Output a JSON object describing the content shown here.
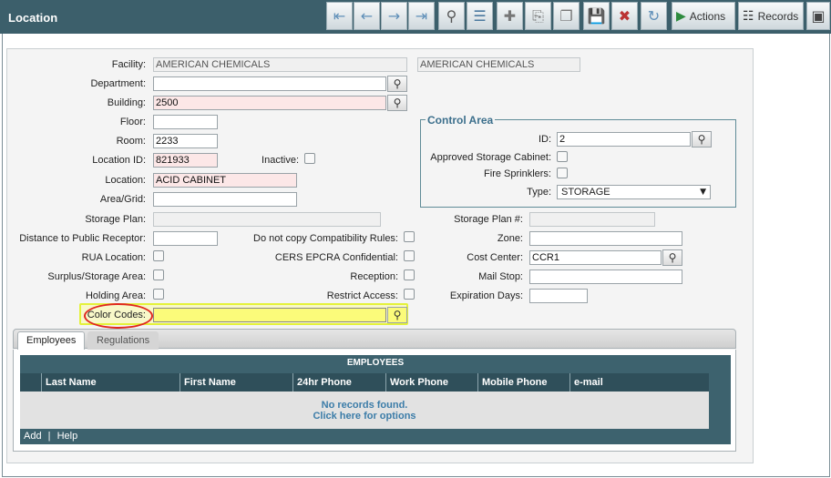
{
  "window": {
    "title": "Location"
  },
  "toolbar": {
    "actions_label": "Actions",
    "records_label": "Records",
    "buttons": [
      "first-record-icon",
      "prev-record-icon",
      "next-record-icon",
      "last-record-icon",
      "search-icon",
      "new-record-icon",
      "copy-record-icon",
      "duplicate-icon",
      "save-icon",
      "delete-icon",
      "refresh-icon"
    ]
  },
  "form": {
    "facility": {
      "label": "Facility:",
      "value": "AMERICAN CHEMICALS",
      "value2": "AMERICAN CHEMICALS"
    },
    "department": {
      "label": "Department:",
      "value": ""
    },
    "building": {
      "label": "Building:",
      "value": "2500"
    },
    "floor": {
      "label": "Floor:",
      "value": ""
    },
    "room": {
      "label": "Room:",
      "value": "2233"
    },
    "location_id": {
      "label": "Location ID:",
      "value": "821933"
    },
    "inactive": {
      "label": "Inactive:"
    },
    "location": {
      "label": "Location:",
      "value": "ACID CABINET"
    },
    "area_grid": {
      "label": "Area/Grid:",
      "value": ""
    },
    "storage_plan": {
      "label": "Storage Plan:",
      "value": ""
    },
    "storage_plan_num": {
      "label": "Storage Plan #:",
      "value": ""
    },
    "distance": {
      "label": "Distance to Public Receptor:",
      "value": ""
    },
    "do_not_copy": {
      "label": "Do not copy Compatibility Rules:"
    },
    "zone": {
      "label": "Zone:",
      "value": ""
    },
    "rua": {
      "label": "RUA Location:"
    },
    "cers": {
      "label": "CERS EPCRA Confidential:"
    },
    "cost_center": {
      "label": "Cost Center:",
      "value": "CCR1"
    },
    "surplus": {
      "label": "Surplus/Storage Area:"
    },
    "reception": {
      "label": "Reception:"
    },
    "mail_stop": {
      "label": "Mail Stop:",
      "value": ""
    },
    "holding": {
      "label": "Holding Area:"
    },
    "restrict": {
      "label": "Restrict Access:"
    },
    "expiration": {
      "label": "Expiration Days:",
      "value": ""
    },
    "color_codes": {
      "label": "Color Codes:",
      "value": ""
    }
  },
  "control_area": {
    "title": "Control Area",
    "id": {
      "label": "ID:",
      "value": "2"
    },
    "approved_cabinet": {
      "label": "Approved Storage Cabinet:"
    },
    "fire_sprinklers": {
      "label": "Fire Sprinklers:"
    },
    "type": {
      "label": "Type:",
      "value": "STORAGE"
    }
  },
  "tabs": [
    {
      "label": "Employees",
      "active": true
    },
    {
      "label": "Regulations",
      "active": false
    }
  ],
  "employees_grid": {
    "title": "EMPLOYEES",
    "columns": [
      "Last Name",
      "First Name",
      "24hr Phone",
      "Work Phone",
      "Mobile Phone",
      "e-mail"
    ],
    "empty_line1": "No records found.",
    "empty_line2": "Click here for options",
    "footer_add": "Add",
    "footer_sep": "|",
    "footer_help": "Help"
  },
  "colors": {
    "titlebar": "#3c5f6b",
    "required_field": "#fce7e7",
    "highlight": "#fbfb7a",
    "annotation_circle": "#e0271f",
    "grid_header": "#2f4f5a",
    "link": "#3b7ca8"
  }
}
